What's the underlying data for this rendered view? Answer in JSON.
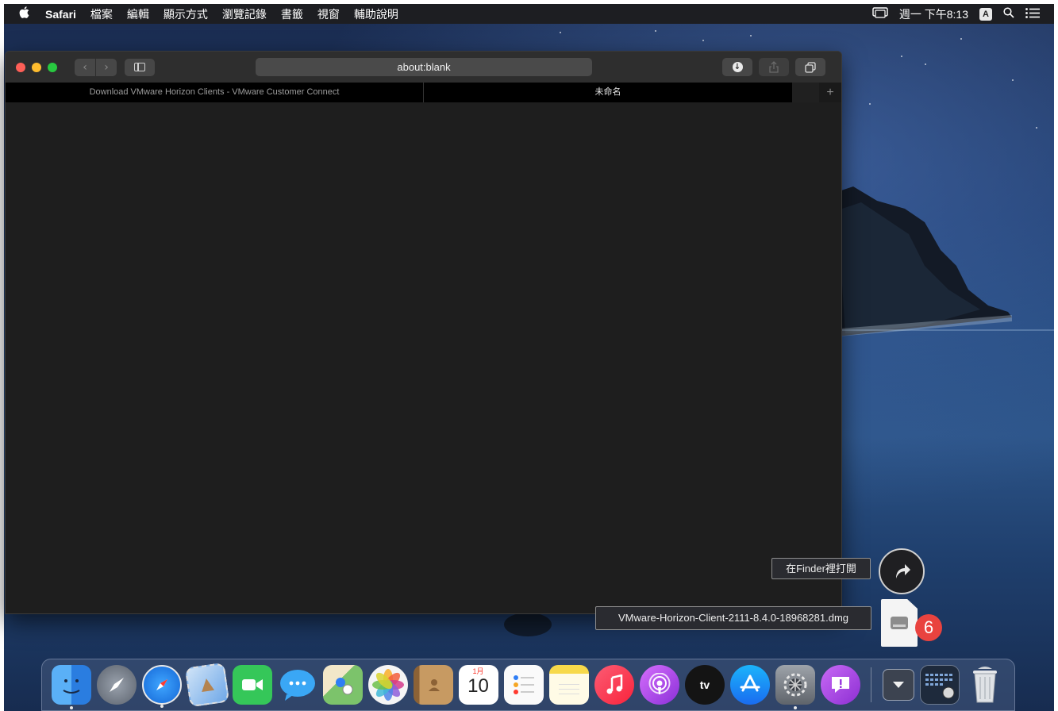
{
  "menubar": {
    "apple_icon": "",
    "app_name": "Safari",
    "items": [
      "檔案",
      "編輯",
      "顯示方式",
      "瀏覽記錄",
      "書籤",
      "視窗",
      "輔助說明"
    ],
    "clock": "週一 下午8:13",
    "input_badge": "A",
    "icons": [
      "screen-mirroring-icon",
      "input-source-icon",
      "spotlight-search-icon",
      "notification-center-icon"
    ]
  },
  "safari": {
    "address": "about:blank",
    "tabs": [
      {
        "title": "Download VMware Horizon Clients - VMware Customer Connect",
        "active": false
      },
      {
        "title": "未命名",
        "active": true
      }
    ],
    "new_tab": "+",
    "nav_back": "‹",
    "nav_forward": "›",
    "toolbar_icons": [
      "download-icon",
      "share-icon",
      "tabs-overview-icon"
    ]
  },
  "downloads_stack": {
    "open_in_finder": "在Finder裡打開",
    "file_name": "VMware-Horizon-Client-2111-8.4.0-18968281.dmg",
    "count": "6"
  },
  "dock": {
    "apps": [
      {
        "name": "finder",
        "color": "#3d8ef0",
        "running": true
      },
      {
        "name": "launchpad",
        "color": "#8a8f99",
        "running": false
      },
      {
        "name": "safari",
        "color": "#2f8ef5",
        "running": true
      },
      {
        "name": "mail",
        "color": "#6fa8e8",
        "running": false
      },
      {
        "name": "facetime",
        "color": "#35c759",
        "running": false
      },
      {
        "name": "messages",
        "color": "#3aa7f5",
        "running": false
      },
      {
        "name": "maps",
        "color": "#7cc36b",
        "running": false
      },
      {
        "name": "photos",
        "color": "#f5f5f5",
        "running": false
      },
      {
        "name": "contacts",
        "color": "#b98a52",
        "running": false
      },
      {
        "name": "calendar",
        "color": "#ffffff",
        "running": false
      },
      {
        "name": "reminders",
        "color": "#fafafa",
        "running": false
      },
      {
        "name": "notes",
        "color": "#f7d94a",
        "running": false
      },
      {
        "name": "music",
        "color": "#fa3b58",
        "running": false
      },
      {
        "name": "podcasts",
        "color": "#a24be0",
        "running": false
      },
      {
        "name": "tv",
        "color": "#141414",
        "running": false
      },
      {
        "name": "app-store",
        "color": "#1e8cf5",
        "running": false
      },
      {
        "name": "system-preferences",
        "color": "#7b7f86",
        "running": true
      },
      {
        "name": "feedback-assistant",
        "color": "#a23fd8",
        "running": false
      }
    ],
    "calendar_month": "1月",
    "calendar_day": "10",
    "tv_label": "tv",
    "stacks": [
      "downloads-stack",
      "screenshots-stack"
    ],
    "trash": "trash"
  }
}
